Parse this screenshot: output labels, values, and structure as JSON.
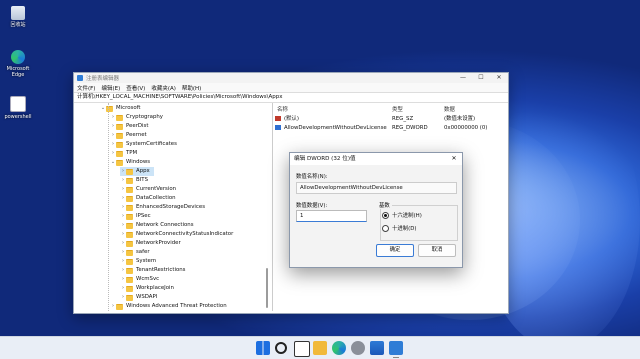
{
  "desktop": {
    "icons": [
      {
        "label": "回收站",
        "icon": "recycle-bin-icon"
      },
      {
        "label": "Microsoft Edge",
        "icon": "edge-icon"
      },
      {
        "label": "powershell",
        "icon": "powershell-icon"
      }
    ]
  },
  "regedit": {
    "title": "注册表编辑器",
    "menu": [
      "文件(F)",
      "编辑(E)",
      "查看(V)",
      "收藏夹(A)",
      "帮助(H)"
    ],
    "address": "计算机\\HKEY_LOCAL_MACHINE\\SOFTWARE\\Policies\\Microsoft\\Windows\\Appx",
    "tree": [
      {
        "label": "Microsoft",
        "level": 1,
        "expanded": true
      },
      {
        "label": "Cryptography",
        "level": 2
      },
      {
        "label": "PeerDist",
        "level": 2
      },
      {
        "label": "Peernet",
        "level": 2
      },
      {
        "label": "SystemCertificates",
        "level": 2
      },
      {
        "label": "TPM",
        "level": 2
      },
      {
        "label": "Windows",
        "level": 2,
        "expanded": true
      },
      {
        "label": "Appx",
        "level": 3,
        "selected": true
      },
      {
        "label": "BITS",
        "level": 3
      },
      {
        "label": "CurrentVersion",
        "level": 3
      },
      {
        "label": "DataCollection",
        "level": 3
      },
      {
        "label": "EnhancedStorageDevices",
        "level": 3
      },
      {
        "label": "IPSec",
        "level": 3
      },
      {
        "label": "Network Connections",
        "level": 3
      },
      {
        "label": "NetworkConnectivityStatusIndicator",
        "level": 3
      },
      {
        "label": "NetworkProvider",
        "level": 3
      },
      {
        "label": "safer",
        "level": 3
      },
      {
        "label": "System",
        "level": 3
      },
      {
        "label": "TenantRestrictions",
        "level": 3
      },
      {
        "label": "WcmSvc",
        "level": 3
      },
      {
        "label": "WorkplaceJoin",
        "level": 3
      },
      {
        "label": "WSDAPI",
        "level": 3
      },
      {
        "label": "Windows Advanced Threat Protection",
        "level": 2
      }
    ],
    "columns": {
      "name": "名称",
      "type": "类型",
      "data": "数据"
    },
    "values": [
      {
        "name": "(默认)",
        "type": "REG_SZ",
        "data": "(数值未设置)",
        "icon": "string-value-icon"
      },
      {
        "name": "AllowDevelopmentWithoutDevLicense",
        "type": "REG_DWORD",
        "data": "0x00000000 (0)",
        "icon": "dword-value-icon"
      }
    ]
  },
  "dialog": {
    "title": "编辑 DWORD (32 位)值",
    "close": "✕",
    "name_label": "数值名称(N):",
    "name_value": "AllowDevelopmentWithoutDevLicense",
    "data_label": "数值数据(V):",
    "data_value": "1",
    "base_label": "基数",
    "hex_label": "十六进制(H)",
    "dec_label": "十进制(D)",
    "ok": "确定",
    "cancel": "取消"
  },
  "window_controls": {
    "minimize": "—",
    "maximize": "☐",
    "close": "✕"
  },
  "taskbar": {
    "icons": [
      "windows-start-icon",
      "search-icon",
      "task-view-icon",
      "file-explorer-icon",
      "edge-icon",
      "settings-icon",
      "store-icon",
      "regedit-icon"
    ]
  }
}
